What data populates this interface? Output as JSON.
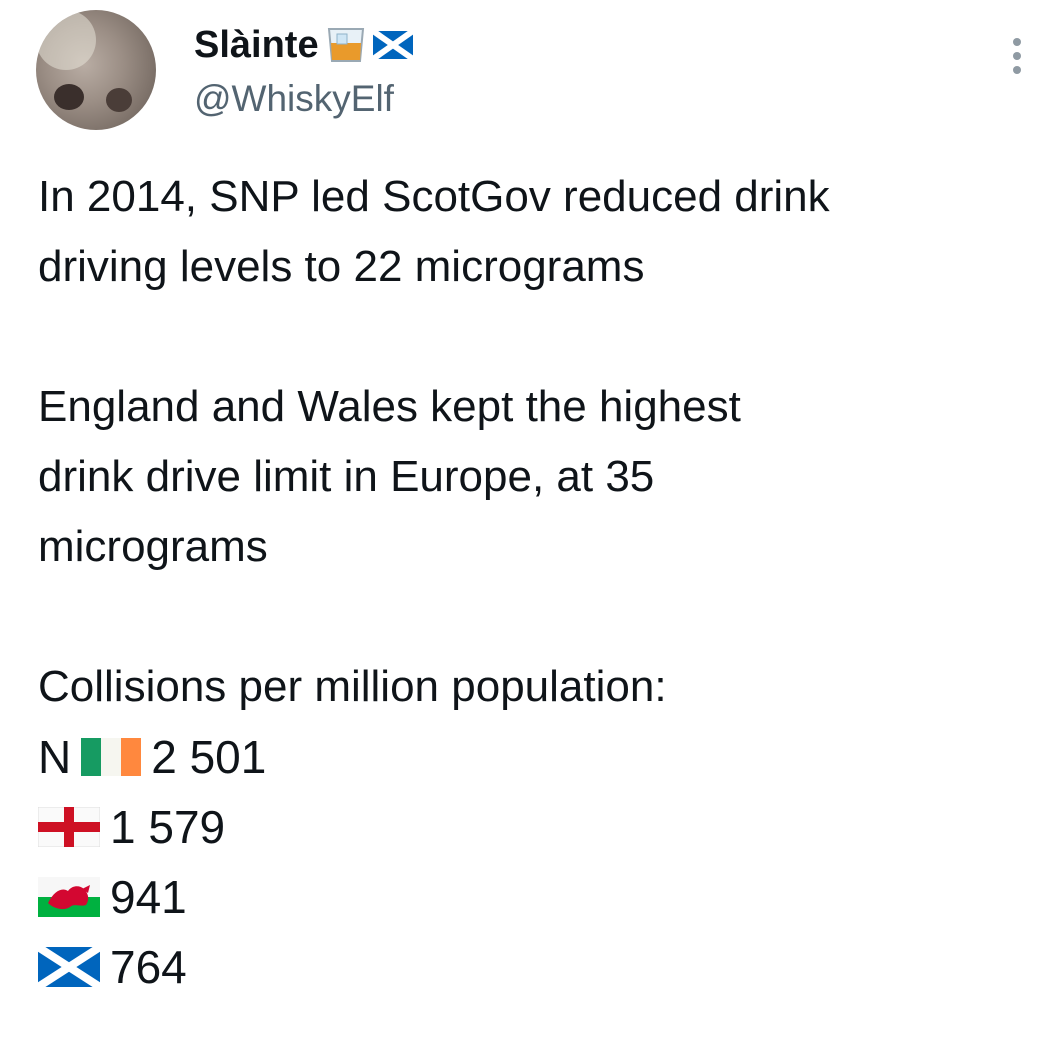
{
  "author": {
    "display_name": "Slàinte",
    "handle": "@WhiskyElf",
    "name_emojis": [
      "whisky-glass-icon",
      "scotland-flag-icon"
    ]
  },
  "tweet": {
    "paragraph1": [
      "In 2014, SNP led ScotGov reduced drink",
      "driving levels to 22 micrograms"
    ],
    "paragraph2": [
      "England and Wales kept the highest",
      "drink drive limit in Europe, at 35",
      "micrograms"
    ],
    "stats_header": "Collisions per million population:",
    "stats": [
      {
        "prefix": "N",
        "flag": "ireland-flag-icon",
        "value": "2 501"
      },
      {
        "prefix": "",
        "flag": "england-flag-icon",
        "value": "1 579"
      },
      {
        "prefix": "",
        "flag": "wales-flag-icon",
        "value": "941"
      },
      {
        "prefix": "",
        "flag": "scotland-flag-icon",
        "value": "764"
      }
    ]
  },
  "colors": {
    "text": "#0f1419",
    "secondary": "#536471",
    "scotland_blue": "#0065bd",
    "england_red": "#ce1124",
    "ireland_green": "#169b62",
    "ireland_orange": "#ff883e",
    "wales_green": "#00b140",
    "wales_red": "#d30731"
  }
}
